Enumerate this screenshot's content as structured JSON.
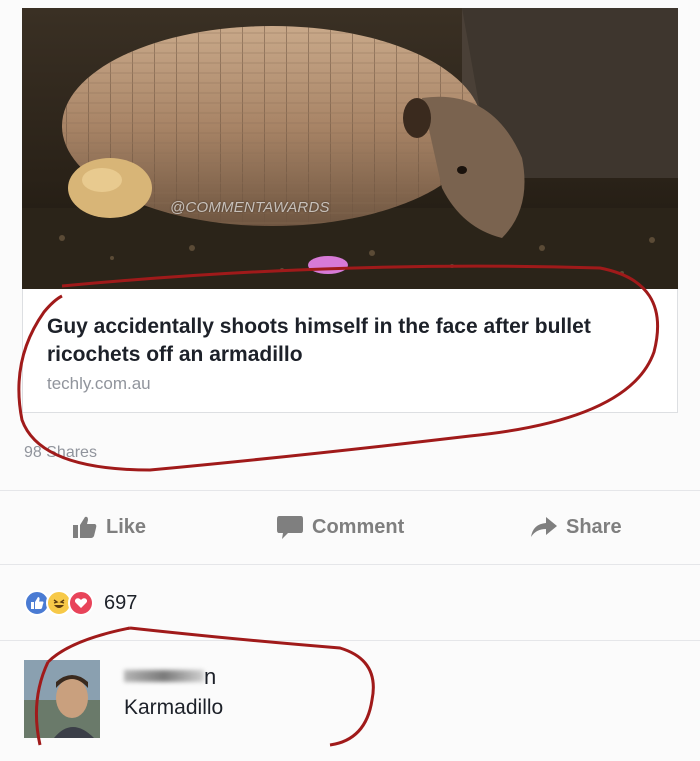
{
  "post": {
    "image_watermark": "@COMMENTAWARDS",
    "link_title": "Guy accidentally shoots himself in the face after bullet ricochets off an armadillo",
    "link_domain": "techly.com.au",
    "shares": "98 Shares"
  },
  "actions": {
    "like": "Like",
    "comment": "Comment",
    "share": "Share"
  },
  "reactions": {
    "icons": [
      "like-reaction-icon",
      "haha-reaction-icon",
      "love-reaction-icon"
    ],
    "count": "697"
  },
  "comment": {
    "author_visible_suffix": "n",
    "text": "Karmadillo"
  },
  "colors": {
    "annotation": "#a01a1a",
    "like_blue": "#4a7bd3",
    "love_red": "#e8445a",
    "haha_yellow": "#f7c948"
  }
}
